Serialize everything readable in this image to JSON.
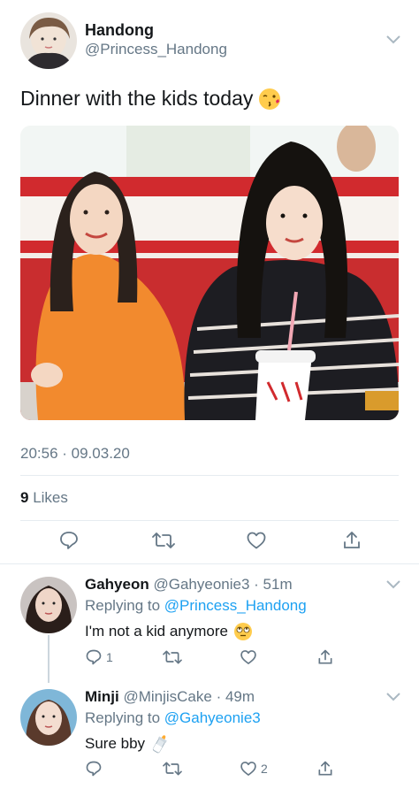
{
  "tweet": {
    "author_name": "Handong",
    "author_handle": "@Princess_Handong",
    "text": "Dinner with the kids today",
    "emoji_icon": "kissing-face-icon",
    "timestamp": "20:56 · 09.03.20",
    "likes_count": "9",
    "likes_label": "Likes"
  },
  "replies": [
    {
      "name": "Gahyeon",
      "handle": "@Gahyeonie3",
      "time": "· 51m",
      "replying_prefix": "Replying to",
      "replying_to": "@Princess_Handong",
      "text": "I'm not a kid anymore",
      "emoji_icon": "eye-roll-face-icon",
      "reply_count": "1",
      "like_count": ""
    },
    {
      "name": "Minji",
      "handle": "@MinjisCake",
      "time": "· 49m",
      "replying_prefix": "Replying to",
      "replying_to": "@Gahyeonie3",
      "text": "Sure bby",
      "emoji_icon": "baby-bottle-icon",
      "reply_count": "",
      "like_count": "2"
    }
  ],
  "colors": {
    "text": "#14171a",
    "secondary": "#657786",
    "link": "#1da1f2",
    "divider": "#e6ecf0"
  }
}
